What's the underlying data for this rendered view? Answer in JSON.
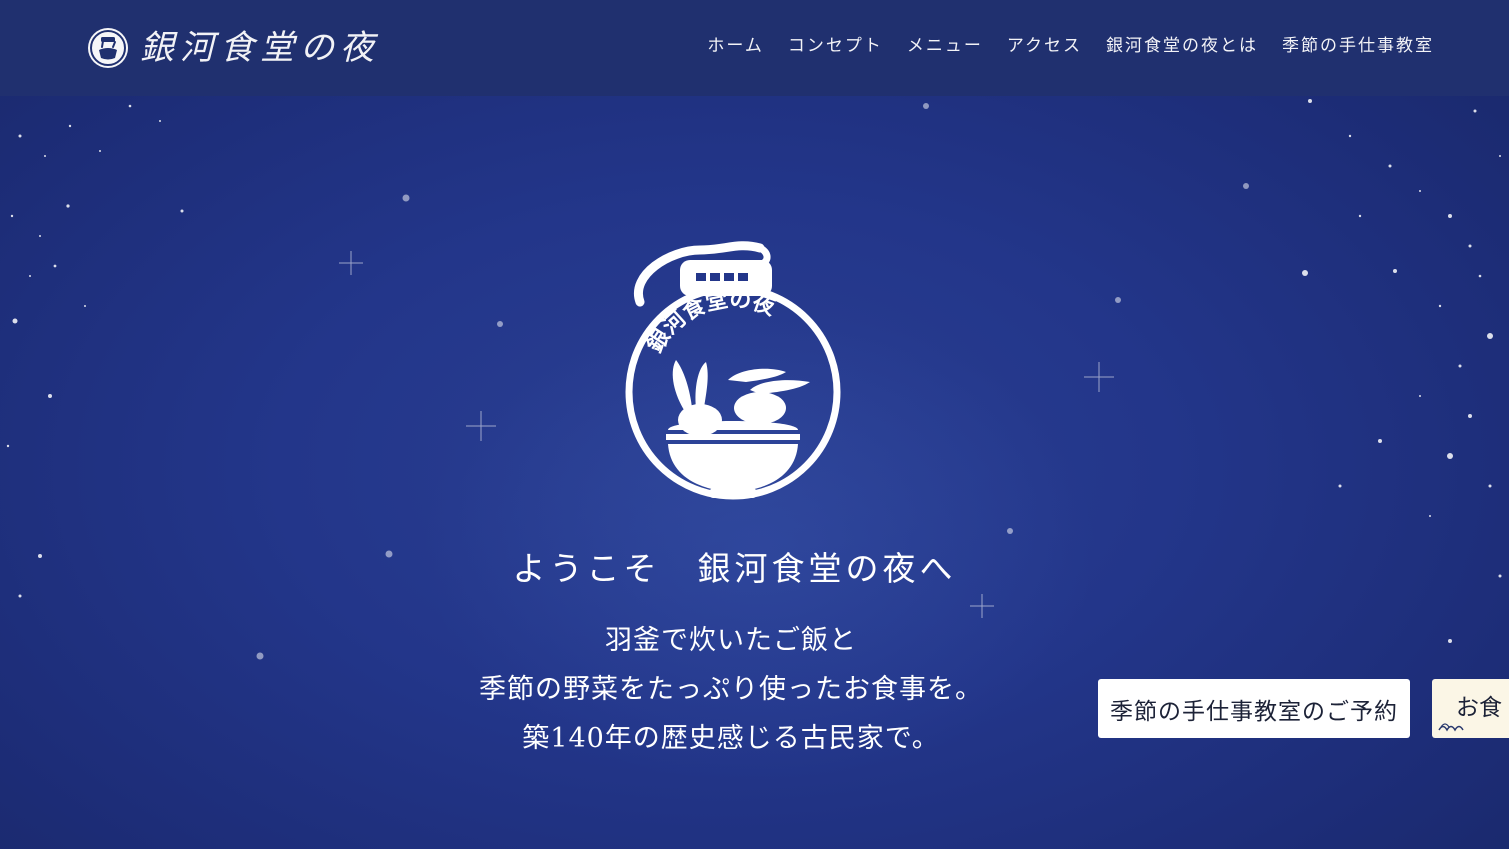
{
  "header": {
    "brand_name": "銀河食堂の夜",
    "nav": [
      {
        "label": "ホーム"
      },
      {
        "label": "コンセプト"
      },
      {
        "label": "メニュー"
      },
      {
        "label": "アクセス"
      },
      {
        "label": "銀河食堂の夜とは"
      },
      {
        "label": "季節の手仕事教室"
      }
    ]
  },
  "hero": {
    "emblem_text": "銀河食堂の夜",
    "welcome": "ようこそ　銀河食堂の夜へ",
    "tagline": [
      "羽釜で炊いたご飯と",
      "季節の野菜をたっぷり使ったお食事を。",
      "築140年の歴史感じる古民家で。"
    ]
  },
  "cta": {
    "workshop_label": "季節の手仕事教室のご予約",
    "meal_label": "お食"
  },
  "icons": {
    "brand": "rice-bowl-logo-icon",
    "emblem": "rabbits-rice-bowl-emblem-icon",
    "wave": "wave-icon"
  },
  "colors": {
    "header_bg": "#20306f",
    "hero_bg": "#23368a",
    "cta_workshop_bg": "#ffffff",
    "cta_meal_bg": "#fbf6e6",
    "text": "#ffffff"
  }
}
